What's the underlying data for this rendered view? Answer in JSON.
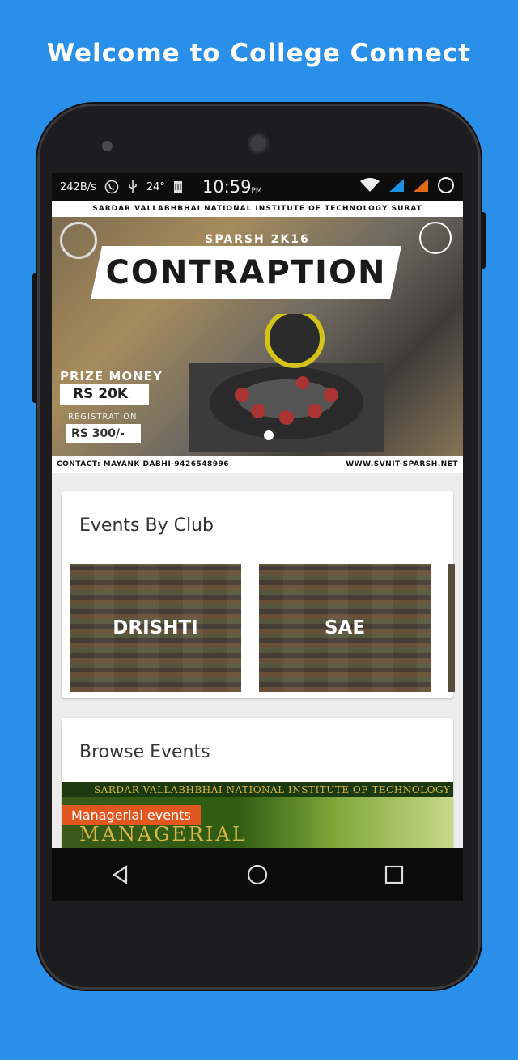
{
  "headline": "Welcome to College Connect",
  "status_bar": {
    "net_speed": "242B/s",
    "temperature": "24°",
    "time": "10:59",
    "time_suffix": "PM"
  },
  "banner": {
    "institute": "SARDAR VALLABHBHAI NATIONAL INSTITUTE OF TECHNOLOGY SURAT",
    "event_series": "SPARSH 2K16",
    "title": "CONTRAPTION",
    "prize_label": "PRIZE MONEY",
    "prize_value": "RS 20K",
    "registration_label": "REGISTRATION",
    "registration_value": "RS 300/-",
    "contact": "CONTACT:  MAYANK DABHI-9426548996",
    "website": "WWW.SVNIT-SPARSH.NET"
  },
  "events_by_club": {
    "title": "Events By Club",
    "clubs": [
      "DRISHTI",
      "SAE"
    ]
  },
  "browse_events": {
    "title": "Browse Events",
    "image_header": "SARDAR VALLABHBHAI NATIONAL INSTITUTE OF TECHNOLOGY",
    "image_big_text": "MANAGERIAL",
    "label": "Managerial events"
  },
  "icons": {
    "whatsapp": "whatsapp-icon",
    "usb": "usb-icon",
    "sim": "sim-icon",
    "wifi": "wifi-icon",
    "signal": "signal-icon",
    "battery": "battery-icon",
    "back": "back-icon",
    "home": "home-icon",
    "recents": "recents-icon"
  },
  "colors": {
    "background": "#2a8fe8",
    "accent": "#e2571f"
  }
}
